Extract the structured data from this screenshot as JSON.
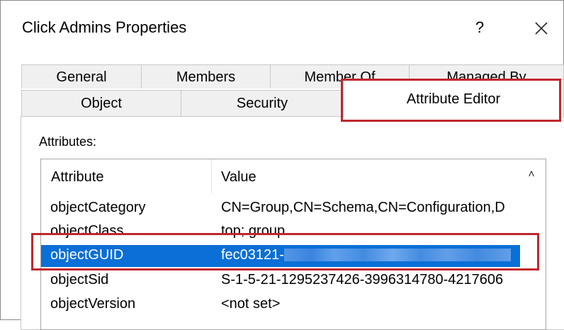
{
  "window": {
    "title": "Click Admins Properties",
    "help_label": "?",
    "close_icon": "close-icon"
  },
  "tabs": {
    "row1": [
      "General",
      "Members",
      "Member Of",
      "Managed By"
    ],
    "row2": [
      "Object",
      "Security",
      "Attribute Editor"
    ],
    "active": "Attribute Editor"
  },
  "attribute_editor": {
    "section_label": "Attributes:",
    "columns": [
      "Attribute",
      "Value"
    ],
    "rows": [
      {
        "attribute": "objectCategory",
        "value": "CN=Group,CN=Schema,CN=Configuration,D"
      },
      {
        "attribute": "objectClass",
        "value": "top; group"
      },
      {
        "attribute": "objectGUID",
        "value": "fec03121-"
      },
      {
        "attribute": "objectSid",
        "value": "S-1-5-21-1295237426-3996314780-4217606"
      },
      {
        "attribute": "objectVersion",
        "value": "<not set>"
      }
    ],
    "selected_row": "objectGUID"
  },
  "colors": {
    "highlight_border": "#c0272d",
    "selection_bg": "#0a6fd6"
  }
}
